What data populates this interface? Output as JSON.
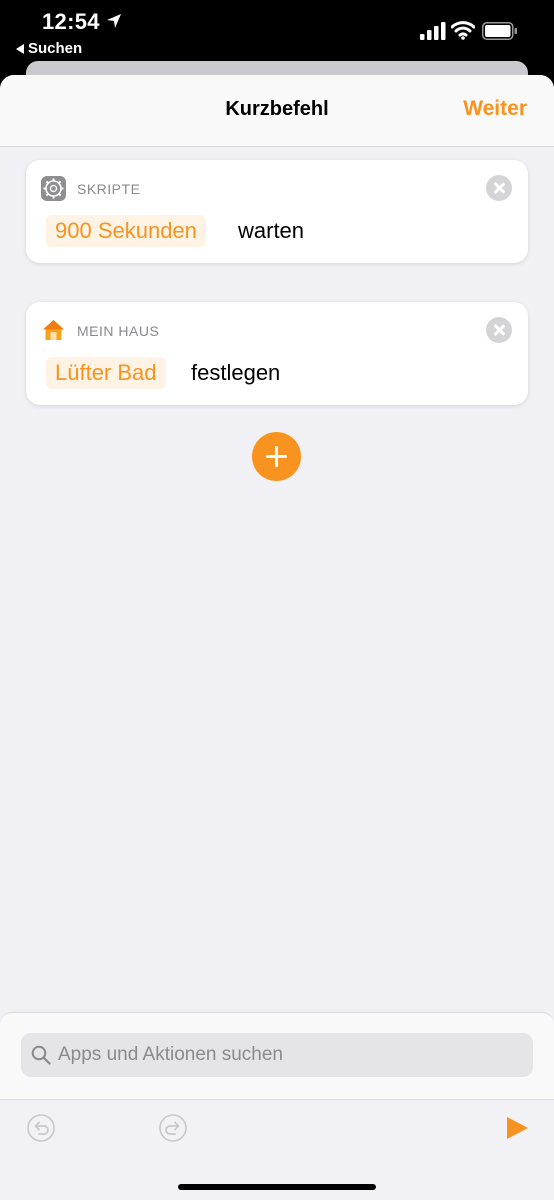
{
  "status_bar": {
    "time": "12:54",
    "back_label": "Suchen"
  },
  "nav": {
    "title": "Kurzbefehl",
    "next_label": "Weiter"
  },
  "actions": [
    {
      "category": "SKRIPTE",
      "icon": "gear-icon",
      "parameter": "900 Sekunden",
      "verb": "warten"
    },
    {
      "category": "MEIN HAUS",
      "icon": "home-icon",
      "parameter": "Lüfter Bad",
      "verb": "festlegen"
    }
  ],
  "search": {
    "placeholder": "Apps und Aktionen suchen"
  },
  "colors": {
    "accent": "#f7931e",
    "param_bg": "#fef3e4",
    "background": "#f1f0f5"
  }
}
